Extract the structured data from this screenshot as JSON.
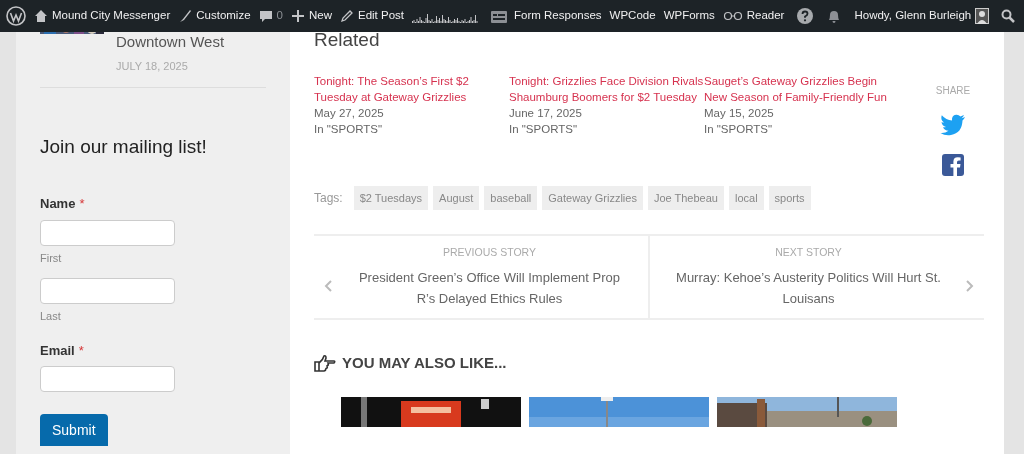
{
  "admin_bar": {
    "site": "Mound City Messenger",
    "items": [
      {
        "kind": "customize",
        "label": "Customize"
      },
      {
        "kind": "comments",
        "label": "0"
      },
      {
        "kind": "new",
        "label": "New"
      },
      {
        "kind": "edit",
        "label": "Edit Post"
      },
      {
        "kind": "stats"
      },
      {
        "kind": "forms",
        "label": "Form Responses"
      },
      {
        "kind": "plain",
        "label": "WPCode"
      },
      {
        "kind": "plain",
        "label": "WPForms"
      },
      {
        "kind": "reader",
        "label": "Reader"
      },
      {
        "kind": "help"
      },
      {
        "kind": "notifications"
      }
    ],
    "account": "Howdy, Glenn Burleigh"
  },
  "sidebar": {
    "recent_post": {
      "title": "Downtown West",
      "date": "JULY 18, 2025"
    },
    "form": {
      "title": "Join our mailing list!",
      "fields": [
        {
          "label": "Name",
          "required": true,
          "required_mark": "*",
          "inputs": [
            {
              "sublabel": "First"
            },
            {
              "sublabel": "Last"
            }
          ]
        },
        {
          "label": "Email",
          "required": true,
          "required_mark": "*"
        }
      ],
      "submit": "Submit"
    }
  },
  "related": {
    "title": "Related",
    "posts": [
      {
        "title": "Tonight: The Season’s First $2 Tuesday at Gateway Grizzlies",
        "date": "May 27, 2025",
        "category": "In \"SPORTS\""
      },
      {
        "title": "Tonight: Grizzlies Face Division Rivals Shaumburg Boomers for $2 Tuesday",
        "date": "June 17, 2025",
        "category": "In \"SPORTS\""
      },
      {
        "title": "Sauget’s Gateway Grizzlies Begin New Season of Family-Friendly Fun",
        "date": "May 15, 2025",
        "category": "In \"SPORTS\""
      }
    ]
  },
  "share": {
    "label": "SHARE",
    "networks": [
      {
        "kind": "twitter",
        "color": "#1da1f2"
      },
      {
        "kind": "facebook",
        "color": "#3b5998"
      }
    ]
  },
  "tags": {
    "label": "Tags:",
    "items": [
      "$2 Tuesdays",
      "August",
      "baseball",
      "Gateway Grizzlies",
      "Joe Thebeau",
      "local",
      "sports"
    ]
  },
  "story_nav": {
    "previous": {
      "label": "PREVIOUS STORY",
      "title": "President Green’s Office Will Implement Prop R’s Delayed Ethics Rules"
    },
    "next": {
      "label": "NEXT STORY",
      "title": "Murray: Kehoe’s Austerity Politics Will Hurt St. Louisans"
    }
  },
  "also_like": {
    "title": "YOU MAY ALSO LIKE..."
  }
}
